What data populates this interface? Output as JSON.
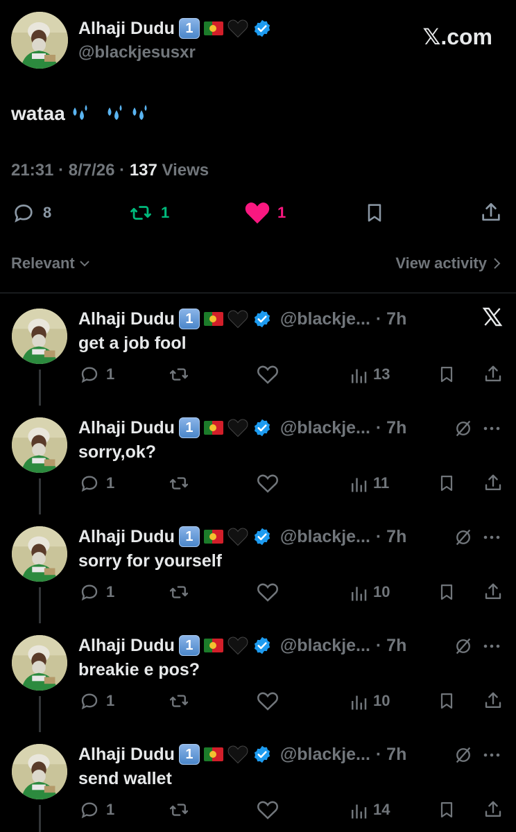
{
  "header": {
    "display_name": "Alhaji Dudu",
    "badge": "1",
    "handle": "@blackjesusxr",
    "site": "𝕏.com"
  },
  "tweet": {
    "text": "wataa",
    "time": "21:31",
    "date": "8/7/26",
    "views_count": "137",
    "views_label": "Views",
    "replies": "8",
    "reposts": "1",
    "likes": "1"
  },
  "filters": {
    "sort_label": "Relevant",
    "activity_label": "View activity"
  },
  "colors": {
    "background": "#000000",
    "text": "#e7e9ea",
    "muted": "#71767b",
    "repost_green": "#00ba7c",
    "like_pink": "#f91880",
    "verified_blue": "#1d9bf0"
  },
  "replies": [
    {
      "display_name": "Alhaji Dudu",
      "badge": "1",
      "handle": "@blackje...",
      "time": "· 7h",
      "text": "get a job fool",
      "replies": "1",
      "views": "13",
      "right_icon": "x-logo-icon"
    },
    {
      "display_name": "Alhaji Dudu",
      "badge": "1",
      "handle": "@blackje...",
      "time": "· 7h",
      "text": "sorry,ok?",
      "replies": "1",
      "views": "11",
      "right_icon": "grok-icon"
    },
    {
      "display_name": "Alhaji Dudu",
      "badge": "1",
      "handle": "@blackje...",
      "time": "· 7h",
      "text": "sorry for yourself",
      "replies": "1",
      "views": "10",
      "right_icon": "grok-icon"
    },
    {
      "display_name": "Alhaji Dudu",
      "badge": "1",
      "handle": "@blackje...",
      "time": "· 7h",
      "text": "breakie e pos?",
      "replies": "1",
      "views": "10",
      "right_icon": "grok-icon"
    },
    {
      "display_name": "Alhaji Dudu",
      "badge": "1",
      "handle": "@blackje...",
      "time": "· 7h",
      "text": "send wallet",
      "replies": "1",
      "views": "14",
      "right_icon": "grok-icon"
    }
  ]
}
